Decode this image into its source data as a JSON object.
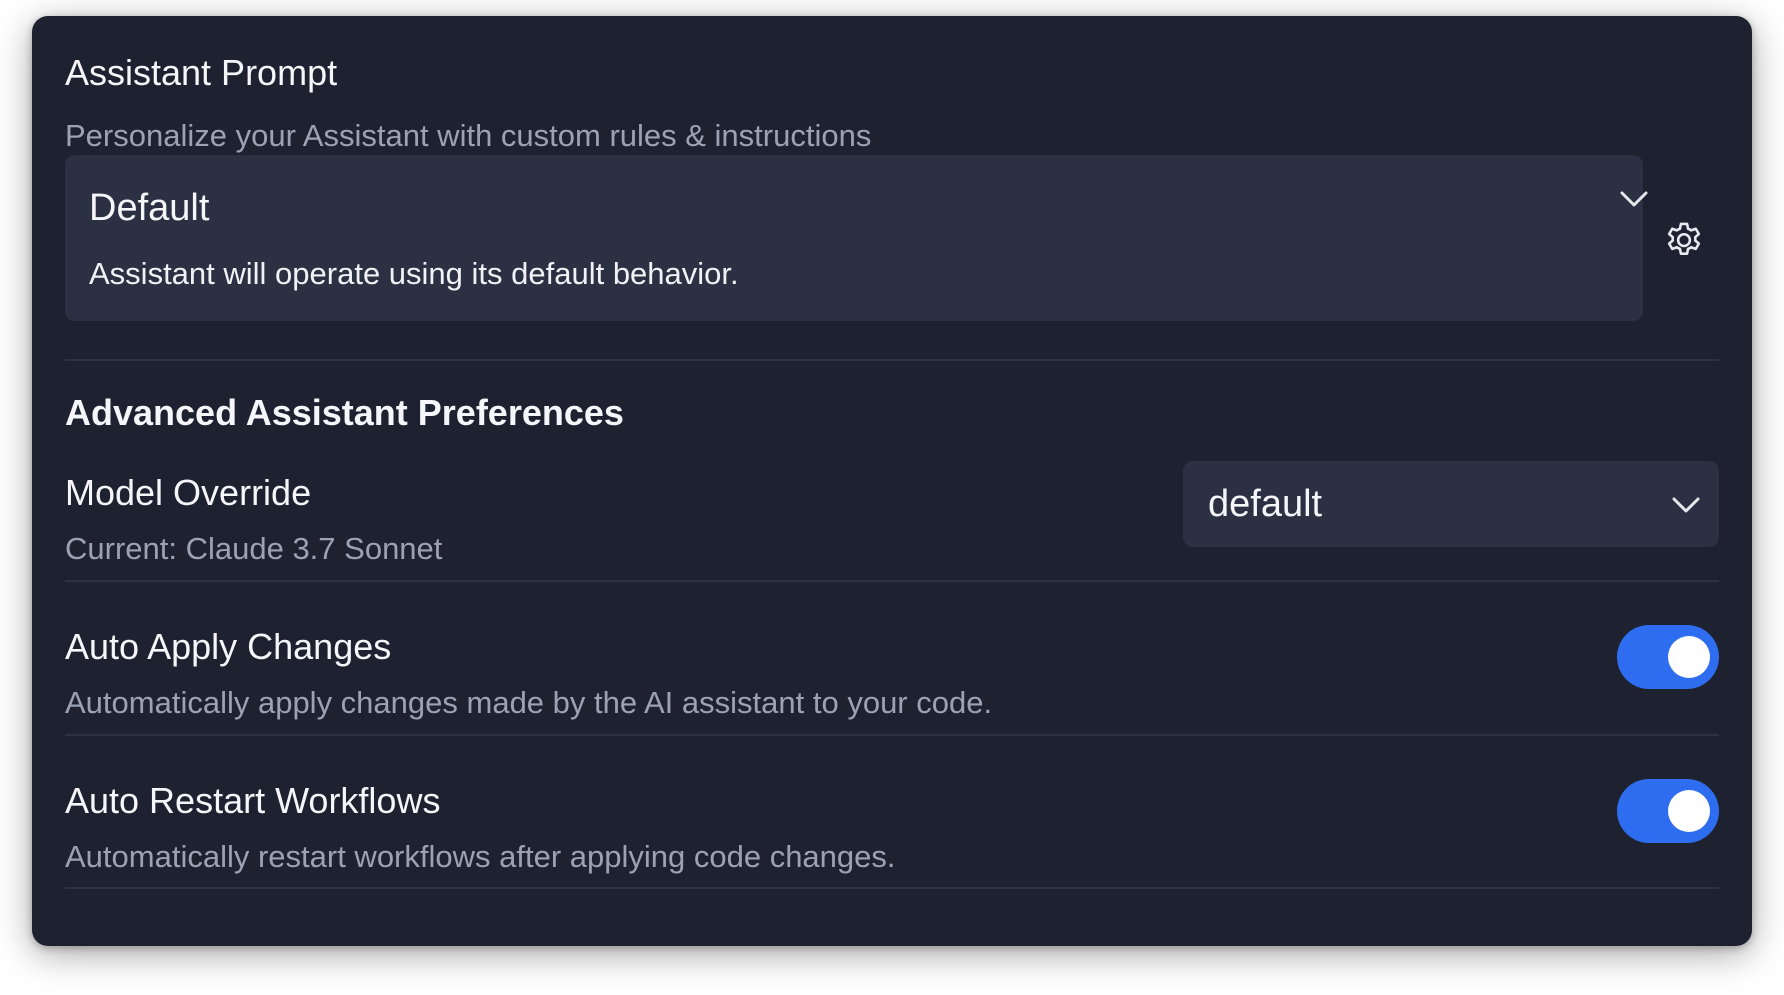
{
  "assistant_prompt": {
    "title": "Assistant Prompt",
    "subtitle": "Personalize your Assistant with custom rules & instructions",
    "selected": {
      "name": "Default",
      "description": "Assistant will operate using its default behavior."
    }
  },
  "advanced": {
    "heading": "Advanced Assistant Preferences",
    "model_override": {
      "label": "Model Override",
      "current": "Current: Claude 3.7 Sonnet",
      "selected_value": "default"
    },
    "auto_apply": {
      "label": "Auto Apply Changes",
      "description": "Automatically apply changes made by the AI assistant to your code.",
      "enabled": true
    },
    "auto_restart": {
      "label": "Auto Restart Workflows",
      "description": "Automatically restart workflows after applying code changes.",
      "enabled": true
    }
  },
  "colors": {
    "panel_bg": "#1e2230",
    "field_bg": "#2b3043",
    "toggle_on": "#2f6df0",
    "muted_text": "#9aa2b4"
  },
  "icons": {
    "prompt_dropdown": "chevron-down-icon",
    "prompt_settings": "gear-icon",
    "model_dropdown": "chevron-down-icon"
  }
}
